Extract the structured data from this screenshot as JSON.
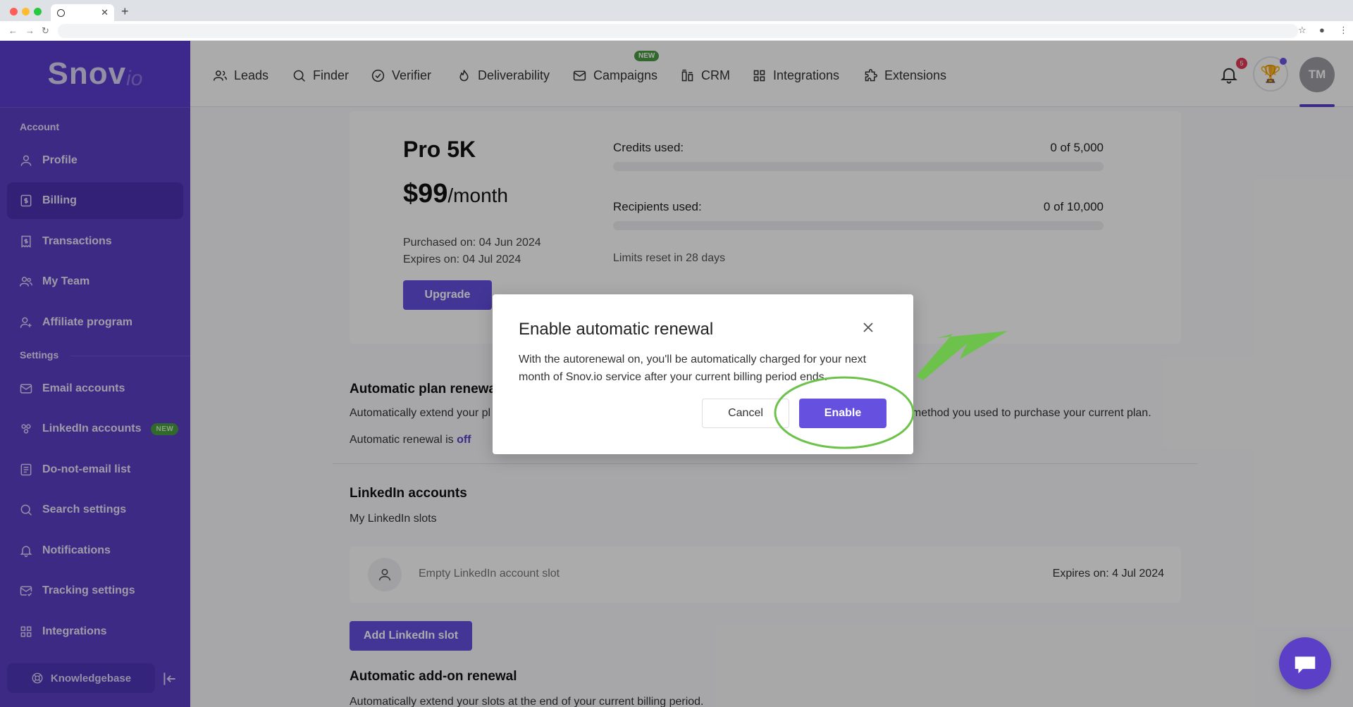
{
  "brand": {
    "logo_main": "Snov",
    "logo_suffix": "io",
    "accent": "#5b3fc7",
    "button": "#6550e0"
  },
  "sidebar": {
    "section_account": "Account",
    "section_settings": "Settings",
    "items": [
      {
        "label": "Profile",
        "icon": "user-icon"
      },
      {
        "label": "Billing",
        "icon": "dollar-doc-icon"
      },
      {
        "label": "Transactions",
        "icon": "receipt-icon"
      },
      {
        "label": "My Team",
        "icon": "team-icon"
      },
      {
        "label": "Affiliate program",
        "icon": "user-plus-icon"
      },
      {
        "label": "Email accounts",
        "icon": "mail-icon"
      },
      {
        "label": "LinkedIn accounts",
        "icon": "users-icon",
        "badge": "NEW"
      },
      {
        "label": "Do-not-email list",
        "icon": "list-doc-icon"
      },
      {
        "label": "Search settings",
        "icon": "search-icon"
      },
      {
        "label": "Notifications",
        "icon": "bell-icon"
      },
      {
        "label": "Tracking settings",
        "icon": "mail-check-icon"
      },
      {
        "label": "Integrations",
        "icon": "grid-icon"
      }
    ],
    "knowledgebase": "Knowledgebase"
  },
  "topnav": {
    "items": [
      "Leads",
      "Finder",
      "Verifier",
      "Deliverability",
      "Campaigns",
      "CRM",
      "Integrations",
      "Extensions"
    ],
    "campaigns_badge": "NEW",
    "notification_count": "5",
    "avatar_initials": "TM"
  },
  "plan": {
    "name": "Pro 5K",
    "price": "$99",
    "period": "/month",
    "purchased": "Purchased on: 04 Jun 2024",
    "expires": "Expires on: 04 Jul 2024",
    "upgrade": "Upgrade",
    "credits_label": "Credits used:",
    "credits_value": "0 of 5,000",
    "recipients_label": "Recipients used:",
    "recipients_value": "0 of 10,000",
    "limits_reset": "Limits reset in 28 days"
  },
  "renewal": {
    "title": "Automatic plan renewal",
    "text_left": "Automatically extend your pl",
    "text_right": "t method you used to purchase your current plan.",
    "status_prefix": "Automatic renewal is",
    "status_value": "off"
  },
  "linkedin": {
    "title": "LinkedIn accounts",
    "subtitle": "My LinkedIn slots",
    "slot_text": "Empty LinkedIn account slot",
    "slot_expires": "Expires on: 4 Jul 2024",
    "add_button": "Add LinkedIn slot"
  },
  "addon": {
    "title": "Automatic add-on renewal",
    "text": "Automatically extend your slots at the end of your current billing period."
  },
  "modal": {
    "title": "Enable automatic renewal",
    "body": "With the autorenewal on, you'll be automatically charged for your next month of Snov.io service after your current billing period ends.",
    "cancel": "Cancel",
    "enable": "Enable"
  }
}
